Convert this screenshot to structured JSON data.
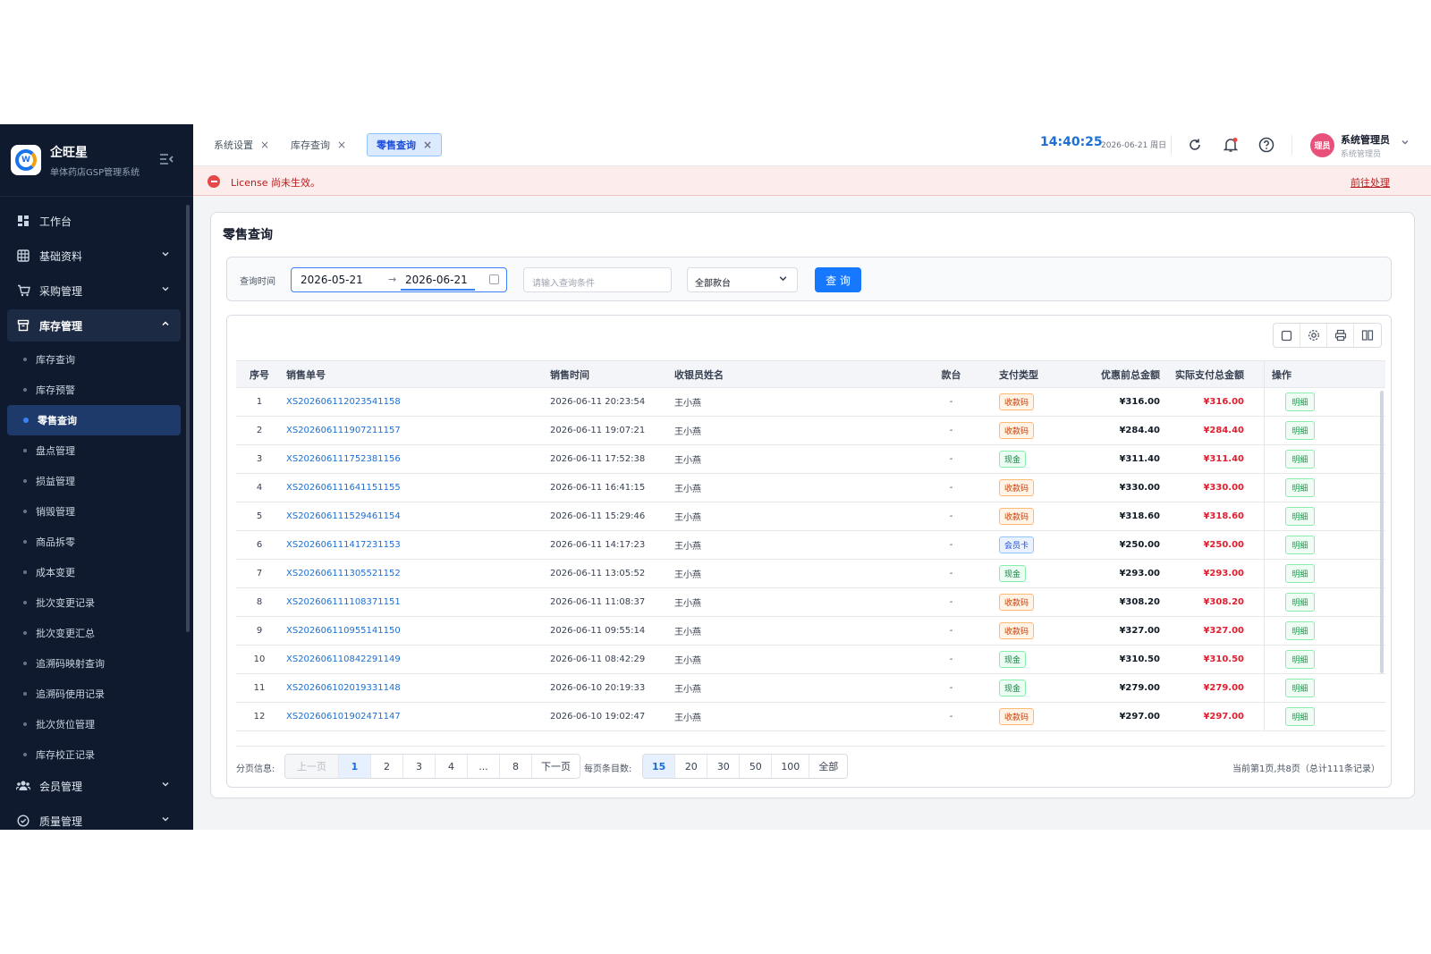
{
  "brand": {
    "name": "企旺星",
    "subtitle": "单体药店GSP管理系统",
    "logo_letter": "W"
  },
  "sidebar": {
    "items": [
      {
        "key": "dashboard",
        "label": "工作台",
        "icon": "dashboard-icon",
        "expandable": false
      },
      {
        "key": "basic",
        "label": "基础资料",
        "icon": "grid-icon",
        "expandable": true
      },
      {
        "key": "purchase",
        "label": "采购管理",
        "icon": "cart-icon",
        "expandable": true
      },
      {
        "key": "inventory",
        "label": "库存管理",
        "icon": "box-icon",
        "expandable": true,
        "open": true
      }
    ],
    "sub_items": [
      {
        "label": "库存查询"
      },
      {
        "label": "库存预警"
      },
      {
        "label": "零售查询",
        "active": true
      },
      {
        "label": "盘点管理"
      },
      {
        "label": "损益管理"
      },
      {
        "label": "销毁管理"
      },
      {
        "label": "商品拆零"
      },
      {
        "label": "成本变更"
      },
      {
        "label": "批次变更记录"
      },
      {
        "label": "批次变更汇总"
      },
      {
        "label": "追溯码映射查询"
      },
      {
        "label": "追溯码使用记录"
      },
      {
        "label": "批次货位管理"
      },
      {
        "label": "库存校正记录"
      }
    ],
    "bottom_items": [
      {
        "key": "member",
        "label": "会员管理",
        "icon": "users-icon"
      },
      {
        "key": "quality",
        "label": "质量管理",
        "icon": "check-circle-icon"
      }
    ]
  },
  "tabs": [
    {
      "label": "系统设置",
      "active": false
    },
    {
      "label": "库存查询",
      "active": false
    },
    {
      "label": "零售查询",
      "active": true
    }
  ],
  "header": {
    "clock": "14:40:25",
    "date": "2026-06-21 周日",
    "user_name": "系统管理员",
    "user_role": "系统管理员",
    "avatar_text": "理员"
  },
  "banner": {
    "message": "License 尚未生效。",
    "link": "前往处理"
  },
  "page": {
    "title": "零售查询",
    "filter": {
      "time_label": "查询时间",
      "date_from": "2026-05-21",
      "date_to": "2026-06-21",
      "search_placeholder": "请输入查询条件",
      "register_select": "全部款台",
      "query_button": "查 询"
    }
  },
  "table": {
    "columns": [
      "序号",
      "销售单号",
      "销售时间",
      "收银员姓名",
      "款台",
      "支付类型",
      "优惠前总金额",
      "实际支付总金额",
      "操作"
    ],
    "rows": [
      {
        "idx": "1",
        "no": "XS202606112023541158",
        "time": "2026-06-11 20:23:54",
        "cashier": "王小燕",
        "register": "-",
        "pay": "收款码",
        "pay_kind": "qr",
        "pre": "¥316.00",
        "actual": "¥316.00",
        "op": "明细"
      },
      {
        "idx": "2",
        "no": "XS202606111907211157",
        "time": "2026-06-11 19:07:21",
        "cashier": "王小燕",
        "register": "-",
        "pay": "收款码",
        "pay_kind": "qr",
        "pre": "¥284.40",
        "actual": "¥284.40",
        "op": "明细"
      },
      {
        "idx": "3",
        "no": "XS202606111752381156",
        "time": "2026-06-11 17:52:38",
        "cashier": "王小燕",
        "register": "-",
        "pay": "现金",
        "pay_kind": "cash",
        "pre": "¥311.40",
        "actual": "¥311.40",
        "op": "明细"
      },
      {
        "idx": "4",
        "no": "XS202606111641151155",
        "time": "2026-06-11 16:41:15",
        "cashier": "王小燕",
        "register": "-",
        "pay": "收款码",
        "pay_kind": "qr",
        "pre": "¥330.00",
        "actual": "¥330.00",
        "op": "明细"
      },
      {
        "idx": "5",
        "no": "XS202606111529461154",
        "time": "2026-06-11 15:29:46",
        "cashier": "王小燕",
        "register": "-",
        "pay": "收款码",
        "pay_kind": "qr",
        "pre": "¥318.60",
        "actual": "¥318.60",
        "op": "明细"
      },
      {
        "idx": "6",
        "no": "XS202606111417231153",
        "time": "2026-06-11 14:17:23",
        "cashier": "王小燕",
        "register": "-",
        "pay": "会员卡",
        "pay_kind": "card",
        "pre": "¥250.00",
        "actual": "¥250.00",
        "op": "明细"
      },
      {
        "idx": "7",
        "no": "XS202606111305521152",
        "time": "2026-06-11 13:05:52",
        "cashier": "王小燕",
        "register": "-",
        "pay": "现金",
        "pay_kind": "cash",
        "pre": "¥293.00",
        "actual": "¥293.00",
        "op": "明细"
      },
      {
        "idx": "8",
        "no": "XS202606111108371151",
        "time": "2026-06-11 11:08:37",
        "cashier": "王小燕",
        "register": "-",
        "pay": "收款码",
        "pay_kind": "qr",
        "pre": "¥308.20",
        "actual": "¥308.20",
        "op": "明细"
      },
      {
        "idx": "9",
        "no": "XS202606110955141150",
        "time": "2026-06-11 09:55:14",
        "cashier": "王小燕",
        "register": "-",
        "pay": "收款码",
        "pay_kind": "qr",
        "pre": "¥327.00",
        "actual": "¥327.00",
        "op": "明细"
      },
      {
        "idx": "10",
        "no": "XS202606110842291149",
        "time": "2026-06-11 08:42:29",
        "cashier": "王小燕",
        "register": "-",
        "pay": "现金",
        "pay_kind": "cash",
        "pre": "¥310.50",
        "actual": "¥310.50",
        "op": "明细"
      },
      {
        "idx": "11",
        "no": "XS202606102019331148",
        "time": "2026-06-10 20:19:33",
        "cashier": "王小燕",
        "register": "-",
        "pay": "现金",
        "pay_kind": "cash",
        "pre": "¥279.00",
        "actual": "¥279.00",
        "op": "明细"
      },
      {
        "idx": "12",
        "no": "XS202606101902471147",
        "time": "2026-06-10 19:02:47",
        "cashier": "王小燕",
        "register": "-",
        "pay": "收款码",
        "pay_kind": "qr",
        "pre": "¥297.00",
        "actual": "¥297.00",
        "op": "明细"
      }
    ]
  },
  "pager": {
    "label": "分页信息:",
    "prev": "上一页",
    "pages": [
      "1",
      "2",
      "3",
      "4",
      "...",
      "8"
    ],
    "current": "1",
    "next": "下一页",
    "size_label": "每页条目数:",
    "sizes": [
      "15",
      "20",
      "30",
      "50",
      "100",
      "全部"
    ],
    "current_size": "15",
    "info": "当前第1页,共8页（总计111条记录）"
  },
  "colors": {
    "accent": "#1677ff",
    "sidebar_bg": "#0f1a2e",
    "danger": "#e11d2e",
    "banner_bg": "#fdecec"
  }
}
